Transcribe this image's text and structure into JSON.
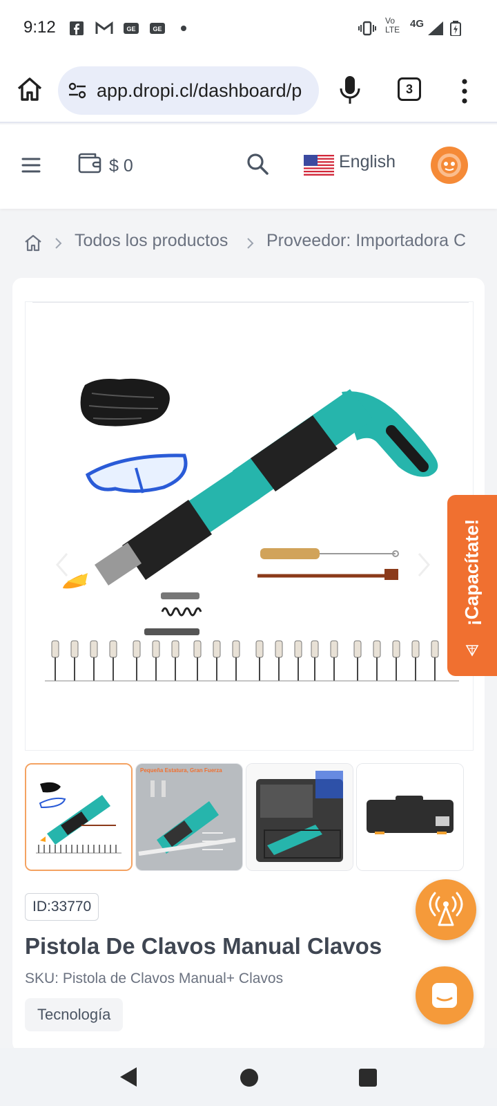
{
  "status_bar": {
    "time": "9:12",
    "left_icons": [
      "facebook-icon",
      "gmail-icon",
      "ge-icon",
      "ge-icon",
      "dot-icon"
    ],
    "network_top": "Vo",
    "network_bottom": "LTE",
    "network_type": "4G",
    "right_icons": [
      "vibrate-icon",
      "signal-icon",
      "battery-icon"
    ]
  },
  "browser": {
    "url": "app.dropi.cl/dashboard/p",
    "tab_count": "3",
    "icons": [
      "home-icon",
      "site-settings-icon",
      "mic-icon",
      "tabs-icon",
      "more-vert-icon"
    ]
  },
  "header": {
    "wallet_amount": "$ 0",
    "language": "English",
    "icons": [
      "menu-icon",
      "wallet-icon",
      "search-icon",
      "us-flag-icon",
      "avatar"
    ]
  },
  "breadcrumb": {
    "items": [
      "Todos los productos",
      "Proveedor: Importadora C"
    ]
  },
  "product": {
    "id": "ID:33770",
    "title": "Pistola De Clavos Manual Clavos",
    "sku": "SKU: Pistola de Clavos Manual+ Clavos",
    "category": "Tecnología",
    "thumbnail_texts": [
      "Pequeña Estatura, Gran Fuerza"
    ],
    "thumb_count": 4,
    "active_thumb": 1
  },
  "floating": {
    "capacitate_label": "¡Capacítate!"
  },
  "colors": {
    "accent": "#f07030",
    "fab": "#f59a3a",
    "teal": "#22b3aa"
  }
}
